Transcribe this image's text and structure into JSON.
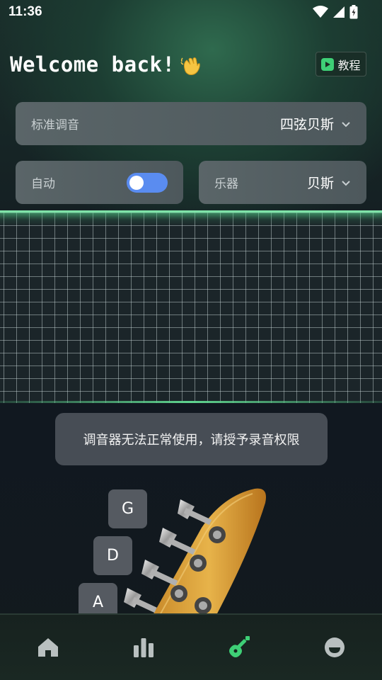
{
  "status_bar": {
    "time": "11:36"
  },
  "header": {
    "title": "Welcome back!",
    "tutorial_label": "教程"
  },
  "tuning": {
    "label": "标准调音",
    "value": "四弦贝斯"
  },
  "auto": {
    "label": "自动",
    "enabled": true
  },
  "instrument": {
    "label": "乐器",
    "value": "贝斯"
  },
  "toast": {
    "message": "调音器无法正常使用，请授予录音权限"
  },
  "strings": [
    {
      "note": "G"
    },
    {
      "note": "D"
    },
    {
      "note": "A"
    }
  ],
  "nav": [
    {
      "icon": "home-icon",
      "active": false
    },
    {
      "icon": "chart-icon",
      "active": false
    },
    {
      "icon": "guitar-icon",
      "active": true
    },
    {
      "icon": "profile-icon",
      "active": false
    }
  ],
  "colors": {
    "accent": "#3ecf76",
    "toggle": "#5a8cf0",
    "nav_inactive": "#b9c0c0"
  }
}
